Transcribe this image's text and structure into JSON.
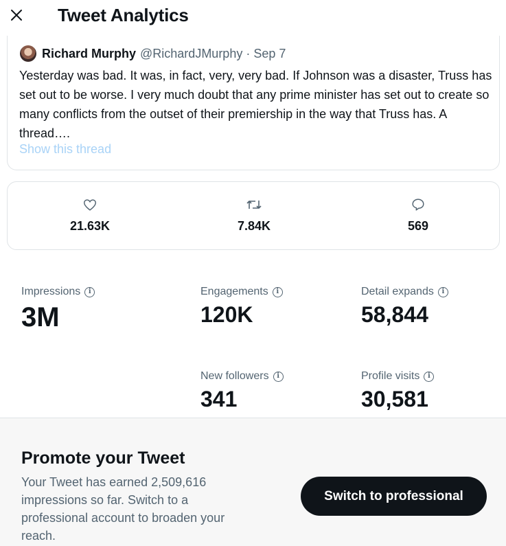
{
  "header": {
    "close_icon": "close-icon",
    "title": "Tweet Analytics"
  },
  "tweet": {
    "author_name": "Richard Murphy",
    "handle_date": "@RichardJMurphy · Sep 7",
    "text": "Yesterday was bad. It was, in fact, very, very bad. If Johnson was a disaster, Truss has set out to be worse. I very much doubt that any prime minister has set out to create so many conflicts from the outset of their premiership in the way that Truss has. A thread….",
    "show_thread": "Show this thread"
  },
  "engagement": {
    "likes": {
      "icon": "heart-icon",
      "value": "21.63K"
    },
    "retweets": {
      "icon": "retweet-icon",
      "value": "7.84K"
    },
    "replies": {
      "icon": "reply-icon",
      "value": "569"
    }
  },
  "stats": {
    "impressions": {
      "label": "Impressions",
      "value": "3M"
    },
    "engagements": {
      "label": "Engagements",
      "value": "120K"
    },
    "detail_expands": {
      "label": "Detail expands",
      "value": "58,844"
    },
    "new_followers": {
      "label": "New followers",
      "value": "341"
    },
    "profile_visits": {
      "label": "Profile visits",
      "value": "30,581"
    }
  },
  "promote": {
    "title": "Promote your Tweet",
    "text": "Your Tweet has earned 2,509,616 impressions so far. Switch to a professional account to broaden your reach.",
    "button_label": "Switch to professional"
  },
  "colors": {
    "text_primary": "#0f1419",
    "text_secondary": "#536471",
    "link_faded": "#a9d3f7",
    "button_bg": "#0f1419"
  }
}
